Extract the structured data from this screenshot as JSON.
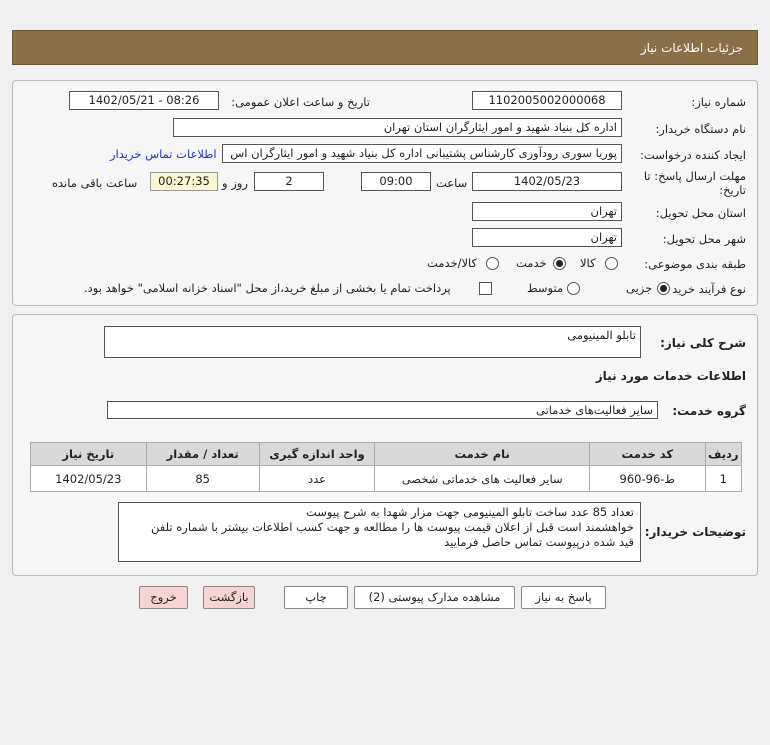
{
  "header": {
    "title": "جزئیات اطلاعات نیاز"
  },
  "form": {
    "need_number": {
      "label": "شماره نیاز:",
      "value": "1102005002000068"
    },
    "announce_datetime": {
      "label": "تاریخ و ساعت اعلان عمومی:",
      "value": "1402/05/21 - 08:26"
    },
    "buyer_org": {
      "label": "نام دستگاه خریدار:",
      "value": "اداره کل بنیاد شهید و امور ایثارگران استان تهران"
    },
    "requester": {
      "label": "ایجاد کننده درخواست:",
      "value": "پوریا سوری رودآوری کارشناس پشتیبانی اداره کل بنیاد شهید و امور ایثارگران اس",
      "contact_link": "اطلاعات تماس خریدار"
    },
    "deadline": {
      "label_line1": "مهلت ارسال پاسخ: تا",
      "label_line2": "تاریخ:",
      "date": "1402/05/23",
      "time_label": "ساعت",
      "time": "09:00",
      "days": "2",
      "days_label": "روز و",
      "remaining": "00:27:35",
      "remaining_label": "ساعت باقی مانده"
    },
    "delivery_province": {
      "label": "استان محل تحویل:",
      "value": "تهران"
    },
    "delivery_city": {
      "label": "شهر محل تحویل:",
      "value": "تهران"
    },
    "category": {
      "label": "طبقه بندی موضوعی:",
      "options": [
        "کالا",
        "خدمت",
        "کالا/خدمت"
      ],
      "selected": "خدمت"
    },
    "purchase_type": {
      "label": "نوع فرآیند خرید :",
      "options": [
        "جزیی",
        "متوسط"
      ],
      "selected": "جزیی",
      "payment_note": "پرداخت تمام یا بخشی از مبلغ خرید،از محل \"اسناد خزانه اسلامی\" خواهد بود."
    }
  },
  "details": {
    "summary_label": "شرح کلی نیاز:",
    "summary_value": "تابلو المینیومی",
    "services_heading": "اطلاعات خدمات مورد نیاز",
    "service_group_label": "گروه خدمت:",
    "service_group_value": "سایر فعالیت‌های خدماتی",
    "table": {
      "headers": [
        "ردیف",
        "کد خدمت",
        "نام خدمت",
        "واحد اندازه گیری",
        "تعداد / مقدار",
        "تاریخ نیاز"
      ],
      "rows": [
        [
          "1",
          "ط-96-960",
          "سایر فعالیت های خدماتی شخصی",
          "عدد",
          "85",
          "1402/05/23"
        ]
      ]
    },
    "buyer_notes_label": "توضیحات خریدار:",
    "buyer_notes_lines": [
      "تعداد 85 عدد ساخت تابلو المینیومی جهت مزار شهدا به شرح پیوست",
      "خواهشمند است قبل از اعلان قیمت پیوست ها را مطالعه و جهت کسب اطلاعات بیشتر با شماره تلفن",
      "قید شده درپیوست تماس حاصل فرمایید"
    ]
  },
  "buttons": {
    "reply": "پاسخ به نیاز",
    "view_docs": "مشاهده مدارک پیوستی (2)",
    "print": "چاپ",
    "back": "بازگشت",
    "exit": "خروج"
  }
}
